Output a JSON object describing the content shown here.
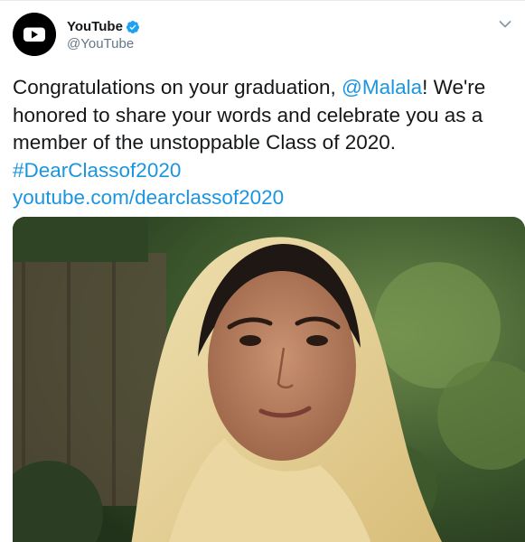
{
  "header": {
    "display_name": "YouTube",
    "handle": "@YouTube",
    "verified": true,
    "avatar_icon": "youtube-play-icon",
    "menu_icon": "chevron-down-icon"
  },
  "tweet": {
    "text_parts": {
      "line1_a": "Congratulations on your graduation, ",
      "mention": "@Malala",
      "line1_b": "! We're",
      "line2": "honored to share your words and celebrate you as a",
      "line3": "member of the unstoppable Class of 2020.",
      "hashtag": "#DearClassof2020",
      "link": "youtube.com/dearclassof2020"
    }
  },
  "media": {
    "type": "video-still"
  },
  "colors": {
    "link": "#1b95e0",
    "text": "#14171a",
    "secondary": "#657786",
    "verified": "#1da1f2"
  }
}
